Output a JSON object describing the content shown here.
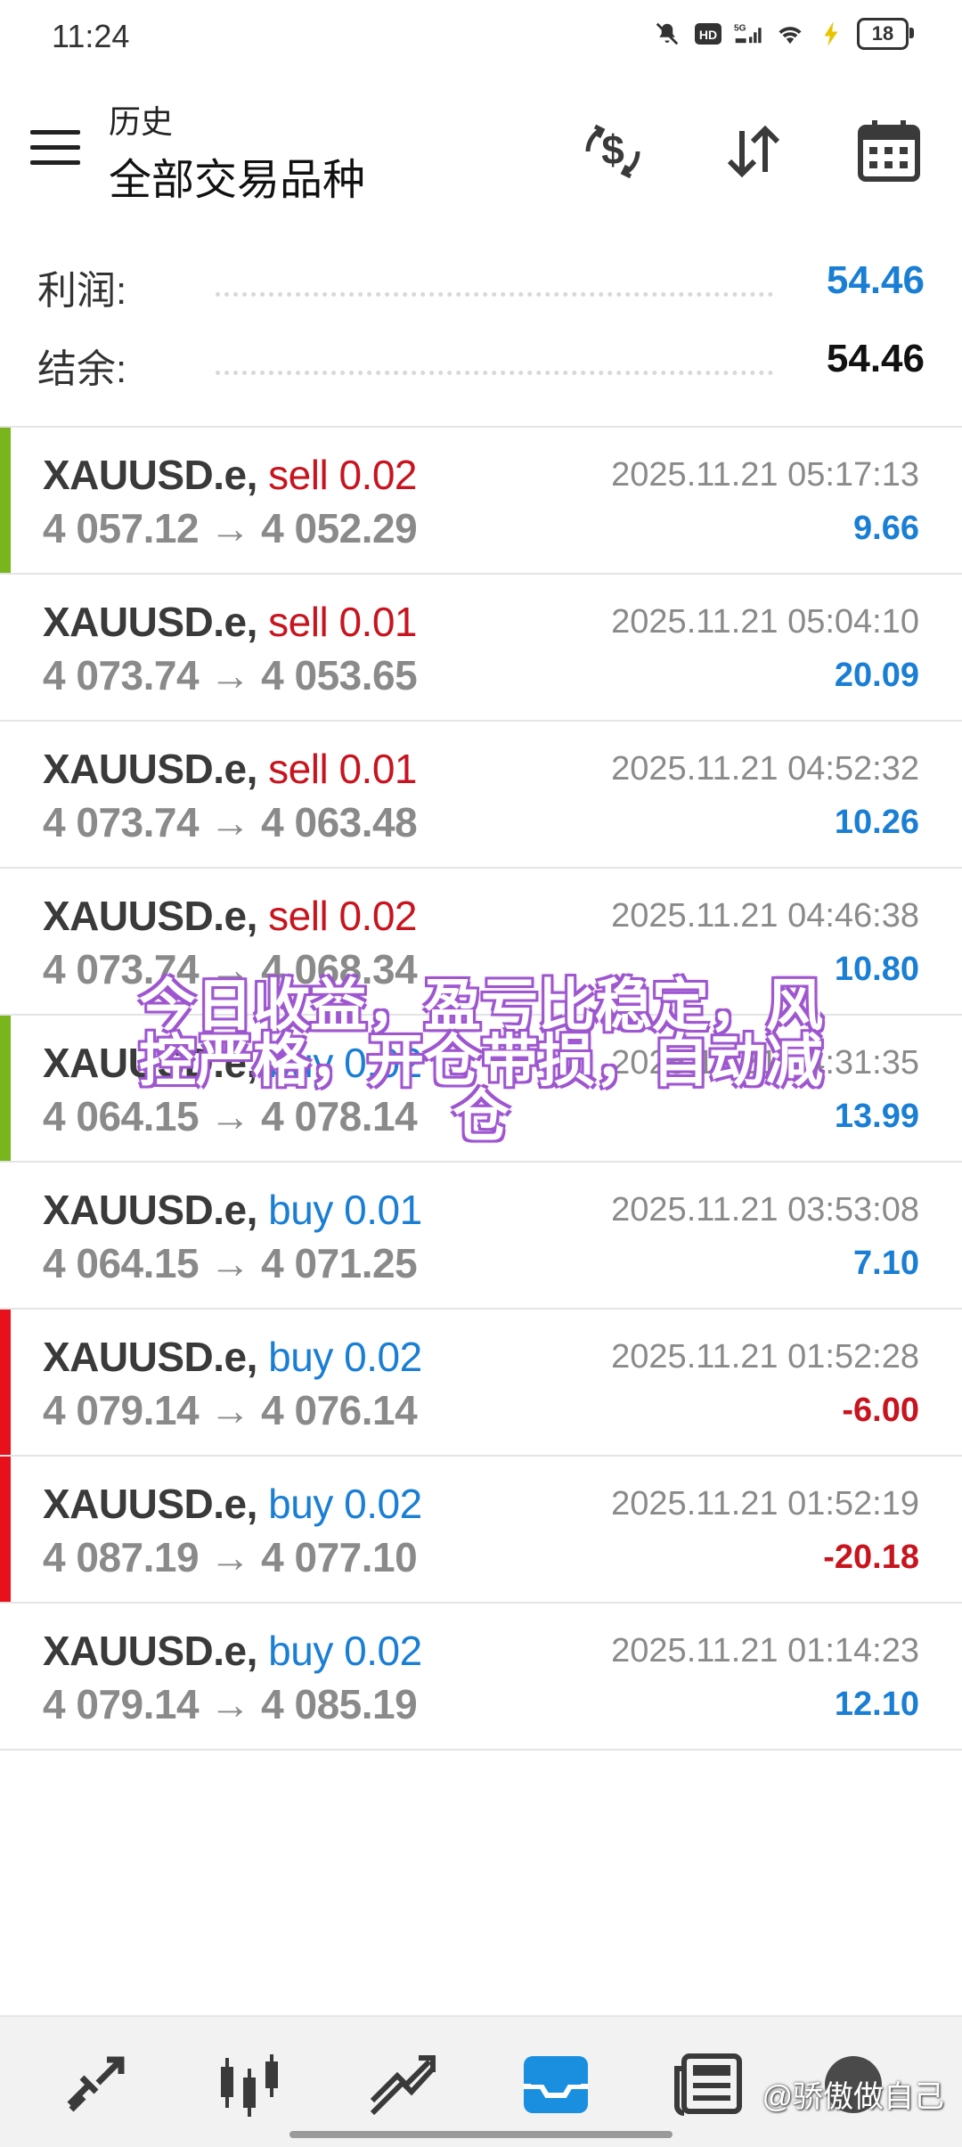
{
  "status": {
    "time": "11:24",
    "battery": "18",
    "network": "5G",
    "hd_badge": "HD"
  },
  "header": {
    "subtitle": "历史",
    "title": "全部交易品种",
    "actions": [
      "currency-exchange-icon",
      "sort-icon",
      "calendar-icon"
    ]
  },
  "summary": {
    "profit_label": "利润:",
    "profit_value": "54.46",
    "balance_label": "结余:",
    "balance_value": "54.46"
  },
  "trades": [
    {
      "symbol": "XAUUSD.e,",
      "side": "sell 0.02",
      "open": "4 057.12",
      "close": "4 052.29",
      "date": "2025.11.21 05:17:13",
      "pl": "9.66",
      "bar": "#79b51c"
    },
    {
      "symbol": "XAUUSD.e,",
      "side": "sell 0.01",
      "open": "4 073.74",
      "close": "4 053.65",
      "date": "2025.11.21 05:04:10",
      "pl": "20.09",
      "bar": ""
    },
    {
      "symbol": "XAUUSD.e,",
      "side": "sell 0.01",
      "open": "4 073.74",
      "close": "4 063.48",
      "date": "2025.11.21 04:52:32",
      "pl": "10.26",
      "bar": ""
    },
    {
      "symbol": "XAUUSD.e,",
      "side": "sell 0.02",
      "open": "4 073.74",
      "close": "4 068.34",
      "date": "2025.11.21 04:46:38",
      "pl": "10.80",
      "bar": ""
    },
    {
      "symbol": "XAUUSD.e,",
      "side": "buy 0.02",
      "open": "4 064.15",
      "close": "4 078.14",
      "date": "2025.11.21 04:31:35",
      "pl": "13.99",
      "bar": "#79b51c"
    },
    {
      "symbol": "XAUUSD.e,",
      "side": "buy 0.01",
      "open": "4 064.15",
      "close": "4 071.25",
      "date": "2025.11.21 03:53:08",
      "pl": "7.10",
      "bar": ""
    },
    {
      "symbol": "XAUUSD.e,",
      "side": "buy 0.02",
      "open": "4 079.14",
      "close": "4 076.14",
      "date": "2025.11.21 01:52:28",
      "pl": "-6.00",
      "bar": "#e8101a"
    },
    {
      "symbol": "XAUUSD.e,",
      "side": "buy 0.02",
      "open": "4 087.19",
      "close": "4 077.10",
      "date": "2025.11.21 01:52:19",
      "pl": "-20.18",
      "bar": "#e8101a"
    },
    {
      "symbol": "XAUUSD.e,",
      "side": "buy 0.02",
      "open": "4 079.14",
      "close": "4 085.19",
      "date": "2025.11.21 01:14:23",
      "pl": "12.10",
      "bar": ""
    }
  ],
  "colors": {
    "sell": "#c8141e",
    "buy": "#1a7fd4",
    "positive": "#1a7fd4",
    "negative": "#c8141e",
    "accent": "#1a7fd4"
  },
  "overlay_text": "今日收益，盈亏比稳定，风控严格，开仓带损，自动减仓",
  "bottom_nav": [
    "quotes-icon",
    "chart-icon",
    "trade-icon",
    "history-icon",
    "news-icon"
  ],
  "watermark": "@骄傲做自己"
}
